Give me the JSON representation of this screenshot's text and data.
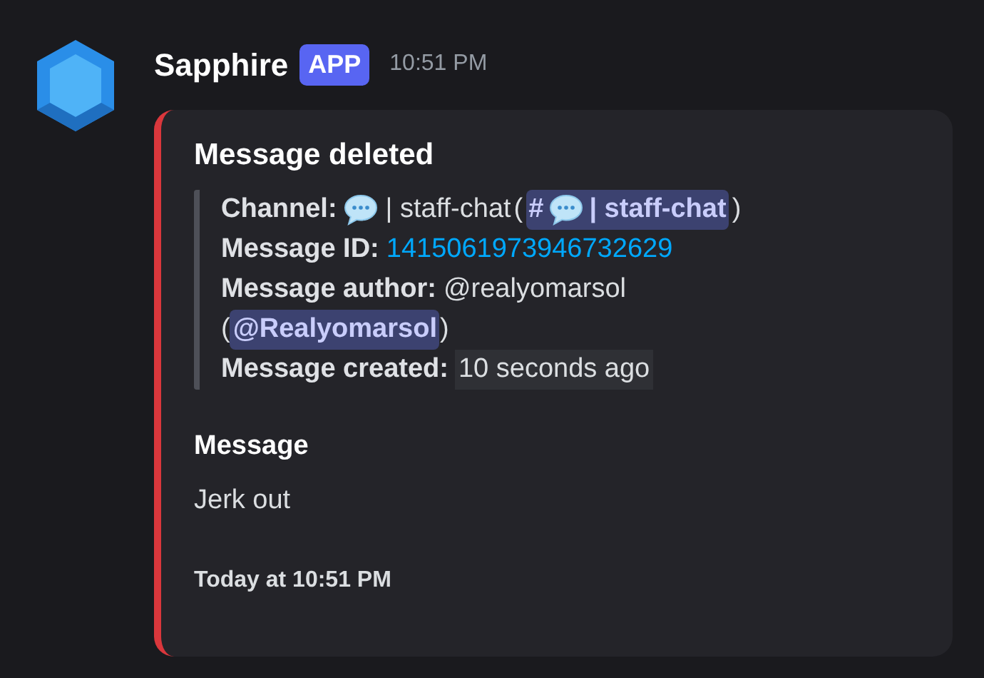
{
  "message": {
    "author": "Sapphire",
    "badge": "APP",
    "time": "10:51 PM"
  },
  "embed": {
    "title": "Message deleted",
    "fields": [
      {
        "kind": "channel",
        "label": "Channel:",
        "channel_name": "| staff-chat",
        "open": "(",
        "mention_prefix": "#",
        "mention_name": "| staff-chat",
        "close": ")"
      },
      {
        "kind": "link",
        "label": "Message ID:",
        "value": "1415061973946732629"
      },
      {
        "kind": "author",
        "label": "Message author:",
        "value": "@realyomarsol",
        "open": "(",
        "mention": "@Realyomarsol",
        "close": ")"
      },
      {
        "kind": "code",
        "label": "Message created:",
        "value": "10 seconds ago"
      }
    ],
    "section": {
      "name": "Message",
      "value": "Jerk out"
    },
    "footer": "Today at 10:51 PM"
  }
}
